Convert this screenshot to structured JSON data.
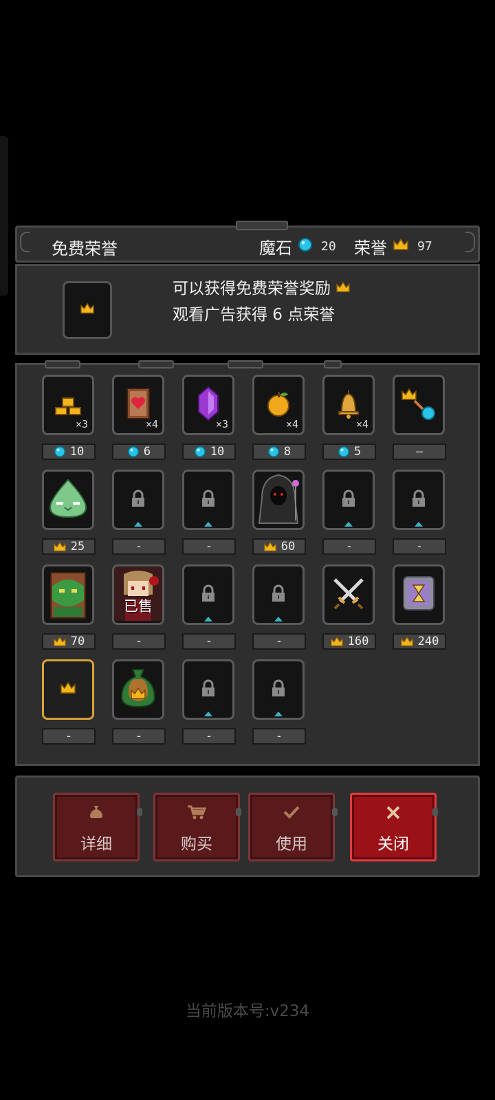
{
  "header": {
    "title": "免费荣誉",
    "magic_stone_label": "魔石",
    "magic_stone_value": "20",
    "honor_label": "荣誉",
    "honor_value": "97"
  },
  "free_panel": {
    "line1": "可以获得免费荣誉奖励",
    "line2": "观看广告获得 6 点荣誉"
  },
  "items": [
    {
      "icon": "gold-bars-icon",
      "qty": "×3",
      "price_icon": "gem",
      "price": "10",
      "state": "normal"
    },
    {
      "icon": "heart-scroll-icon",
      "qty": "×4",
      "price_icon": "gem",
      "price": "6",
      "state": "normal"
    },
    {
      "icon": "purple-crystal-icon",
      "qty": "×3",
      "price_icon": "gem",
      "price": "10",
      "state": "normal"
    },
    {
      "icon": "golden-apple-icon",
      "qty": "×4",
      "price_icon": "gem",
      "price": "8",
      "state": "normal"
    },
    {
      "icon": "bell-icon",
      "qty": "×4",
      "price_icon": "gem",
      "price": "5",
      "state": "normal"
    },
    {
      "icon": "crown-to-gem-icon",
      "qty": "",
      "price_icon": "",
      "price": "—",
      "state": "normal"
    },
    {
      "icon": "green-slime-icon",
      "qty": "",
      "price_icon": "crown",
      "price": "25",
      "state": "normal"
    },
    {
      "icon": "lock-icon",
      "qty": "",
      "price_icon": "",
      "price": "-",
      "state": "locked"
    },
    {
      "icon": "lock-icon",
      "qty": "",
      "price_icon": "",
      "price": "-",
      "state": "locked"
    },
    {
      "icon": "dark-reaper-icon",
      "qty": "",
      "price_icon": "crown",
      "price": "60",
      "state": "normal"
    },
    {
      "icon": "lock-icon",
      "qty": "",
      "price_icon": "",
      "price": "-",
      "state": "locked"
    },
    {
      "icon": "lock-icon",
      "qty": "",
      "price_icon": "",
      "price": "-",
      "state": "locked"
    },
    {
      "icon": "treant-icon",
      "qty": "",
      "price_icon": "crown",
      "price": "70",
      "state": "normal"
    },
    {
      "icon": "girl-character-icon",
      "qty": "",
      "price_icon": "",
      "price": "-",
      "state": "sold",
      "sold_label": "已售"
    },
    {
      "icon": "lock-icon",
      "qty": "",
      "price_icon": "",
      "price": "-",
      "state": "locked"
    },
    {
      "icon": "lock-icon",
      "qty": "",
      "price_icon": "",
      "price": "-",
      "state": "locked"
    },
    {
      "icon": "crossed-swords-icon",
      "qty": "",
      "price_icon": "crown",
      "price": "160",
      "state": "normal"
    },
    {
      "icon": "hourglass-icon",
      "qty": "",
      "price_icon": "crown",
      "price": "240",
      "state": "normal"
    },
    {
      "icon": "crown-icon",
      "qty": "",
      "price_icon": "",
      "price": "-",
      "state": "selected"
    },
    {
      "icon": "crown-bag-icon",
      "qty": "",
      "price_icon": "",
      "price": "-",
      "state": "normal"
    },
    {
      "icon": "lock-icon",
      "qty": "",
      "price_icon": "",
      "price": "-",
      "state": "locked"
    },
    {
      "icon": "lock-icon",
      "qty": "",
      "price_icon": "",
      "price": "-",
      "state": "locked"
    }
  ],
  "buttons": {
    "detail": "详细",
    "buy": "购买",
    "use": "使用",
    "close": "关闭"
  },
  "version": "当前版本号:v234",
  "colors": {
    "gem": "#29c3e8",
    "crown": "#f2b51c",
    "panel": "#2e2e2e",
    "border": "#4a4a4a",
    "button_red": "#9a1118",
    "button_dark_red": "#5a1a1c"
  }
}
